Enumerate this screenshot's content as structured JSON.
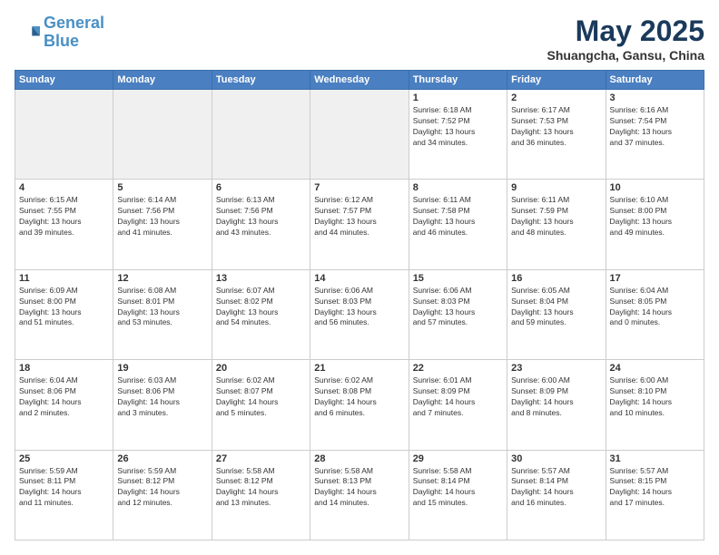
{
  "header": {
    "logo_line1": "General",
    "logo_line2": "Blue",
    "title": "May 2025",
    "subtitle": "Shuangcha, Gansu, China"
  },
  "weekdays": [
    "Sunday",
    "Monday",
    "Tuesday",
    "Wednesday",
    "Thursday",
    "Friday",
    "Saturday"
  ],
  "weeks": [
    [
      {
        "day": "",
        "info": ""
      },
      {
        "day": "",
        "info": ""
      },
      {
        "day": "",
        "info": ""
      },
      {
        "day": "",
        "info": ""
      },
      {
        "day": "1",
        "info": "Sunrise: 6:18 AM\nSunset: 7:52 PM\nDaylight: 13 hours\nand 34 minutes."
      },
      {
        "day": "2",
        "info": "Sunrise: 6:17 AM\nSunset: 7:53 PM\nDaylight: 13 hours\nand 36 minutes."
      },
      {
        "day": "3",
        "info": "Sunrise: 6:16 AM\nSunset: 7:54 PM\nDaylight: 13 hours\nand 37 minutes."
      }
    ],
    [
      {
        "day": "4",
        "info": "Sunrise: 6:15 AM\nSunset: 7:55 PM\nDaylight: 13 hours\nand 39 minutes."
      },
      {
        "day": "5",
        "info": "Sunrise: 6:14 AM\nSunset: 7:56 PM\nDaylight: 13 hours\nand 41 minutes."
      },
      {
        "day": "6",
        "info": "Sunrise: 6:13 AM\nSunset: 7:56 PM\nDaylight: 13 hours\nand 43 minutes."
      },
      {
        "day": "7",
        "info": "Sunrise: 6:12 AM\nSunset: 7:57 PM\nDaylight: 13 hours\nand 44 minutes."
      },
      {
        "day": "8",
        "info": "Sunrise: 6:11 AM\nSunset: 7:58 PM\nDaylight: 13 hours\nand 46 minutes."
      },
      {
        "day": "9",
        "info": "Sunrise: 6:11 AM\nSunset: 7:59 PM\nDaylight: 13 hours\nand 48 minutes."
      },
      {
        "day": "10",
        "info": "Sunrise: 6:10 AM\nSunset: 8:00 PM\nDaylight: 13 hours\nand 49 minutes."
      }
    ],
    [
      {
        "day": "11",
        "info": "Sunrise: 6:09 AM\nSunset: 8:00 PM\nDaylight: 13 hours\nand 51 minutes."
      },
      {
        "day": "12",
        "info": "Sunrise: 6:08 AM\nSunset: 8:01 PM\nDaylight: 13 hours\nand 53 minutes."
      },
      {
        "day": "13",
        "info": "Sunrise: 6:07 AM\nSunset: 8:02 PM\nDaylight: 13 hours\nand 54 minutes."
      },
      {
        "day": "14",
        "info": "Sunrise: 6:06 AM\nSunset: 8:03 PM\nDaylight: 13 hours\nand 56 minutes."
      },
      {
        "day": "15",
        "info": "Sunrise: 6:06 AM\nSunset: 8:03 PM\nDaylight: 13 hours\nand 57 minutes."
      },
      {
        "day": "16",
        "info": "Sunrise: 6:05 AM\nSunset: 8:04 PM\nDaylight: 13 hours\nand 59 minutes."
      },
      {
        "day": "17",
        "info": "Sunrise: 6:04 AM\nSunset: 8:05 PM\nDaylight: 14 hours\nand 0 minutes."
      }
    ],
    [
      {
        "day": "18",
        "info": "Sunrise: 6:04 AM\nSunset: 8:06 PM\nDaylight: 14 hours\nand 2 minutes."
      },
      {
        "day": "19",
        "info": "Sunrise: 6:03 AM\nSunset: 8:06 PM\nDaylight: 14 hours\nand 3 minutes."
      },
      {
        "day": "20",
        "info": "Sunrise: 6:02 AM\nSunset: 8:07 PM\nDaylight: 14 hours\nand 5 minutes."
      },
      {
        "day": "21",
        "info": "Sunrise: 6:02 AM\nSunset: 8:08 PM\nDaylight: 14 hours\nand 6 minutes."
      },
      {
        "day": "22",
        "info": "Sunrise: 6:01 AM\nSunset: 8:09 PM\nDaylight: 14 hours\nand 7 minutes."
      },
      {
        "day": "23",
        "info": "Sunrise: 6:00 AM\nSunset: 8:09 PM\nDaylight: 14 hours\nand 8 minutes."
      },
      {
        "day": "24",
        "info": "Sunrise: 6:00 AM\nSunset: 8:10 PM\nDaylight: 14 hours\nand 10 minutes."
      }
    ],
    [
      {
        "day": "25",
        "info": "Sunrise: 5:59 AM\nSunset: 8:11 PM\nDaylight: 14 hours\nand 11 minutes."
      },
      {
        "day": "26",
        "info": "Sunrise: 5:59 AM\nSunset: 8:12 PM\nDaylight: 14 hours\nand 12 minutes."
      },
      {
        "day": "27",
        "info": "Sunrise: 5:58 AM\nSunset: 8:12 PM\nDaylight: 14 hours\nand 13 minutes."
      },
      {
        "day": "28",
        "info": "Sunrise: 5:58 AM\nSunset: 8:13 PM\nDaylight: 14 hours\nand 14 minutes."
      },
      {
        "day": "29",
        "info": "Sunrise: 5:58 AM\nSunset: 8:14 PM\nDaylight: 14 hours\nand 15 minutes."
      },
      {
        "day": "30",
        "info": "Sunrise: 5:57 AM\nSunset: 8:14 PM\nDaylight: 14 hours\nand 16 minutes."
      },
      {
        "day": "31",
        "info": "Sunrise: 5:57 AM\nSunset: 8:15 PM\nDaylight: 14 hours\nand 17 minutes."
      }
    ]
  ]
}
